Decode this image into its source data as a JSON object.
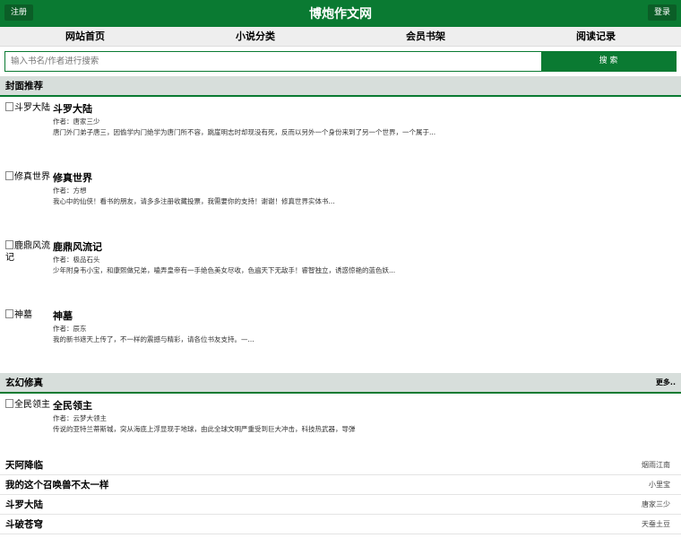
{
  "header": {
    "title": "博炮作文网",
    "register": "注册",
    "login": "登录"
  },
  "nav": [
    "网站首页",
    "小说分类",
    "会员书架",
    "阅读记录"
  ],
  "search": {
    "placeholder": "输入书名/作者进行搜索",
    "button": "搜 索"
  },
  "cover_section": {
    "title": "封面推荐",
    "books": [
      {
        "cover_alt": "斗罗大陆",
        "name": "斗罗大陆",
        "author": "作者：唐家三少",
        "desc": "唐门外门弟子唐三，因偷学内门绝学为唐门所不容，跳崖明志时却现没有死，反而以另外一个身份来到了另一个世界，一个属于..."
      },
      {
        "cover_alt": "修真世界",
        "name": "修真世界",
        "author": "作者：方想",
        "desc": "我心中的仙侠！看书的朋友，请多多注册收藏投票，我需要你的支持！谢谢！修真世界实体书..."
      },
      {
        "cover_alt": "鹿鼎风流记",
        "name": "鹿鼎风流记",
        "author": "作者：极品石头",
        "desc": "少年附身韦小宝，和康熙做兄弟，嗑弄皇帝有一手绝色美女尽收，色遍天下无敌手！睿智独立，诱惑惊艳的蓝色妖..."
      },
      {
        "cover_alt": "神墓",
        "name": "神墓",
        "author": "作者：辰东",
        "desc": "我的新书遮天上传了，不一样的震撼与精彩，请各位书友支持。—..."
      }
    ]
  },
  "fantasy_section": {
    "title": "玄幻修真",
    "more": "更多..",
    "featured": {
      "cover_alt": "全民领主",
      "name": "全民领主",
      "author": "作者：云梦大领主",
      "desc": "传说的亚特兰蒂斯城，突从海底上浮显现于地球，由此全球文明严重受到巨大冲击，科技热武器，导弹"
    },
    "list": [
      {
        "title": "天阿降临",
        "author": "烟雨江南"
      },
      {
        "title": "我的这个召唤兽不太一样",
        "author": "小里宝"
      },
      {
        "title": "斗罗大陆",
        "author": "唐家三少"
      },
      {
        "title": "斗破苍穹",
        "author": "天蚕土豆"
      }
    ]
  },
  "colors": {
    "primary": "#0a7a32",
    "section_bg": "#d7dedb",
    "nav_bg": "#eeeeee"
  }
}
